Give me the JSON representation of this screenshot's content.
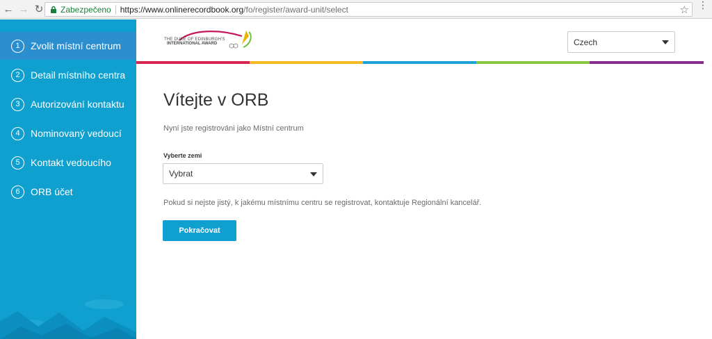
{
  "browser": {
    "secure_label": "Zabezpečeno",
    "url_host": "https://www.onlinerecordbook.org",
    "url_path": "/fo/register/award-unit/select",
    "back_icon": "back-arrow-icon",
    "forward_icon": "forward-arrow-icon",
    "reload_icon": "reload-icon"
  },
  "sidebar": {
    "items": [
      {
        "num": "1",
        "label": "Zvolit místní centrum"
      },
      {
        "num": "2",
        "label": "Detail místního centra"
      },
      {
        "num": "3",
        "label": "Autorizování kontaktu"
      },
      {
        "num": "4",
        "label": "Nominovaný vedoucí"
      },
      {
        "num": "5",
        "label": "Kontakt vedoucího"
      },
      {
        "num": "6",
        "label": "ORB účet"
      }
    ],
    "active_index": 0
  },
  "header": {
    "logo_line1": "THE DUKE OF EDINBURGH'S",
    "logo_line2": "INTERNATIONAL AWARD",
    "language": "Czech",
    "stripe_colors": [
      "#d6254f",
      "#f5b823",
      "#1aa3d4",
      "#8ac540",
      "#8a2b90"
    ]
  },
  "main": {
    "title": "Vítejte v ORB",
    "subtitle": "Nyní jste registrováni jako Místní centrum",
    "country_label": "Vyberte zemi",
    "country_value": "Vybrat",
    "hint": "Pokud si nejste jistý, k jakému místnímu centru se registrovat, kontaktuje Regionální kancelář.",
    "continue_label": "Pokračovat"
  },
  "colors": {
    "sidebar_bg": "#0fa0cf",
    "sidebar_active": "#2b8fcf",
    "primary_button": "#0fa0cf"
  }
}
